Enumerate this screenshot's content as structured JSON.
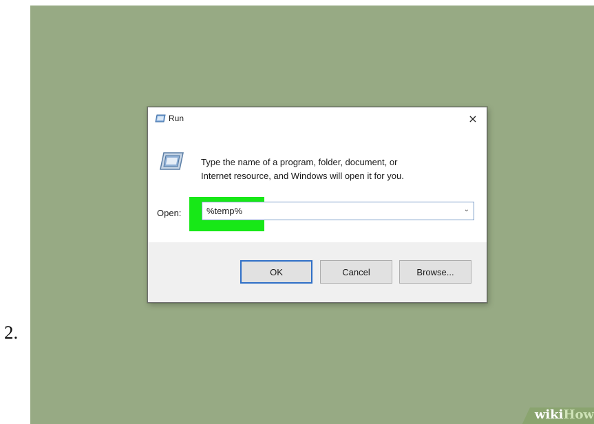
{
  "step": {
    "number": "2."
  },
  "dialog": {
    "title": "Run",
    "description_line1": "Type the name of a program, folder, document, or",
    "description_line2": "Internet resource, and Windows will open it for you.",
    "open_label": "Open:",
    "open_value": "%temp%",
    "buttons": {
      "ok": "OK",
      "cancel": "Cancel",
      "browse": "Browse..."
    },
    "close_glyph": "×",
    "dropdown_glyph": "⌄"
  },
  "watermark": {
    "part1": "wiki",
    "part2": "How"
  },
  "colors": {
    "background": "#97aa84",
    "highlight": "#17e817",
    "accent": "#2f6fc7"
  },
  "icons": [
    "run-title-icon",
    "run-program-icon",
    "close-icon",
    "chevron-down-icon"
  ]
}
